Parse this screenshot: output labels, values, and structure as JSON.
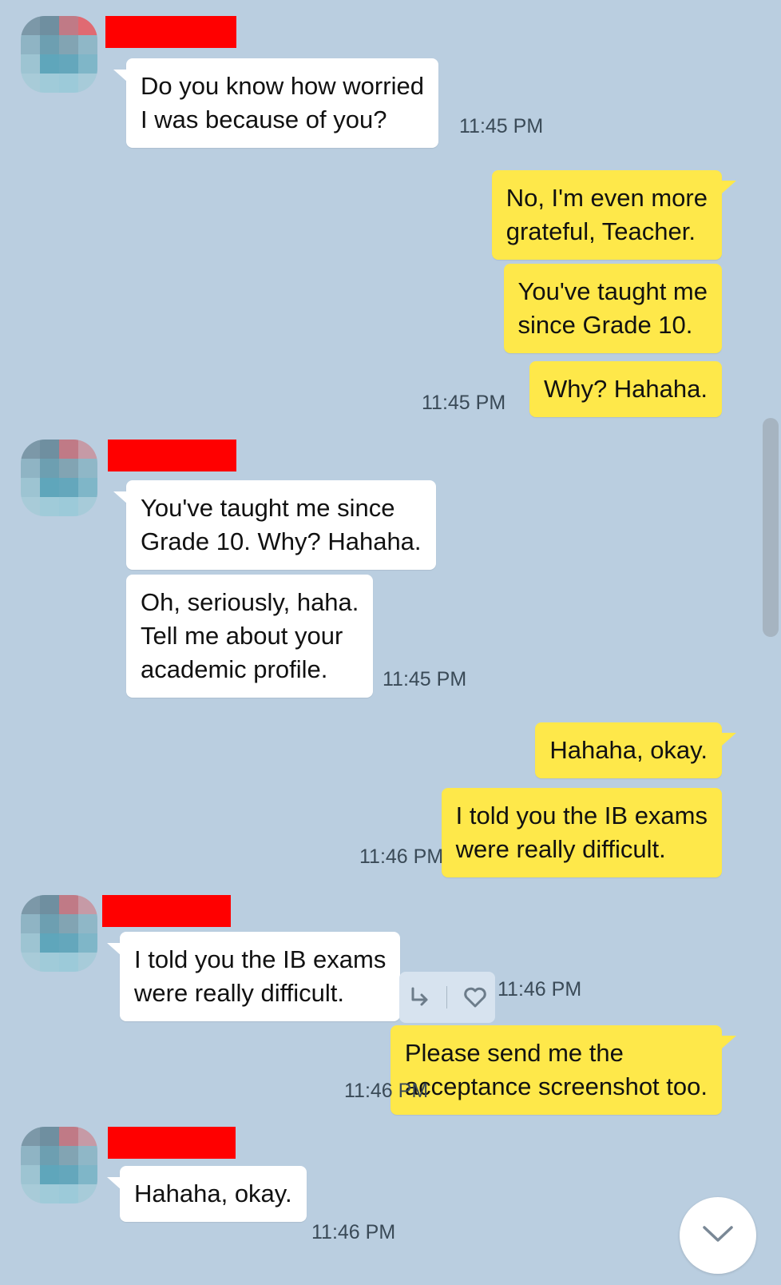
{
  "messages": [
    {
      "side": "in",
      "text": "Do you know how worried\nI was because of you?",
      "time": "11:45 PM"
    },
    {
      "side": "out",
      "text": "No, I'm even more\ngrateful, Teacher."
    },
    {
      "side": "out",
      "text": "You've taught me\nsince Grade 10."
    },
    {
      "side": "out",
      "text": "Why? Hahaha.",
      "time": "11:45 PM"
    },
    {
      "side": "in",
      "text": "You've taught me since\nGrade 10. Why? Hahaha."
    },
    {
      "side": "in",
      "text": "Oh, seriously, haha.\nTell me about your\nacademic profile.",
      "time": "11:45 PM"
    },
    {
      "side": "out",
      "text": "Hahaha, okay."
    },
    {
      "side": "out",
      "text": "I told you the IB exams\nwere really difficult.",
      "time": "11:46 PM"
    },
    {
      "side": "in",
      "text": "I told you the IB exams\nwere really difficult.",
      "time": "11:46 PM"
    },
    {
      "side": "out",
      "text": "Please send me the\nacceptance screenshot too.",
      "time": "11:46 PM"
    },
    {
      "side": "in",
      "text": "Hahaha, okay.",
      "time": "11:46 PM"
    }
  ],
  "icons": {
    "reply": "reply-arrow-icon",
    "like": "heart-icon",
    "scroll_down": "chevron-down-icon",
    "avatar": "pixelated-avatar",
    "name_redaction": "red-redaction-bar"
  },
  "colors": {
    "background": "#bacee0",
    "incoming_bubble": "#ffffff",
    "outgoing_bubble": "#fee84a",
    "name_redaction": "#ff0000"
  }
}
